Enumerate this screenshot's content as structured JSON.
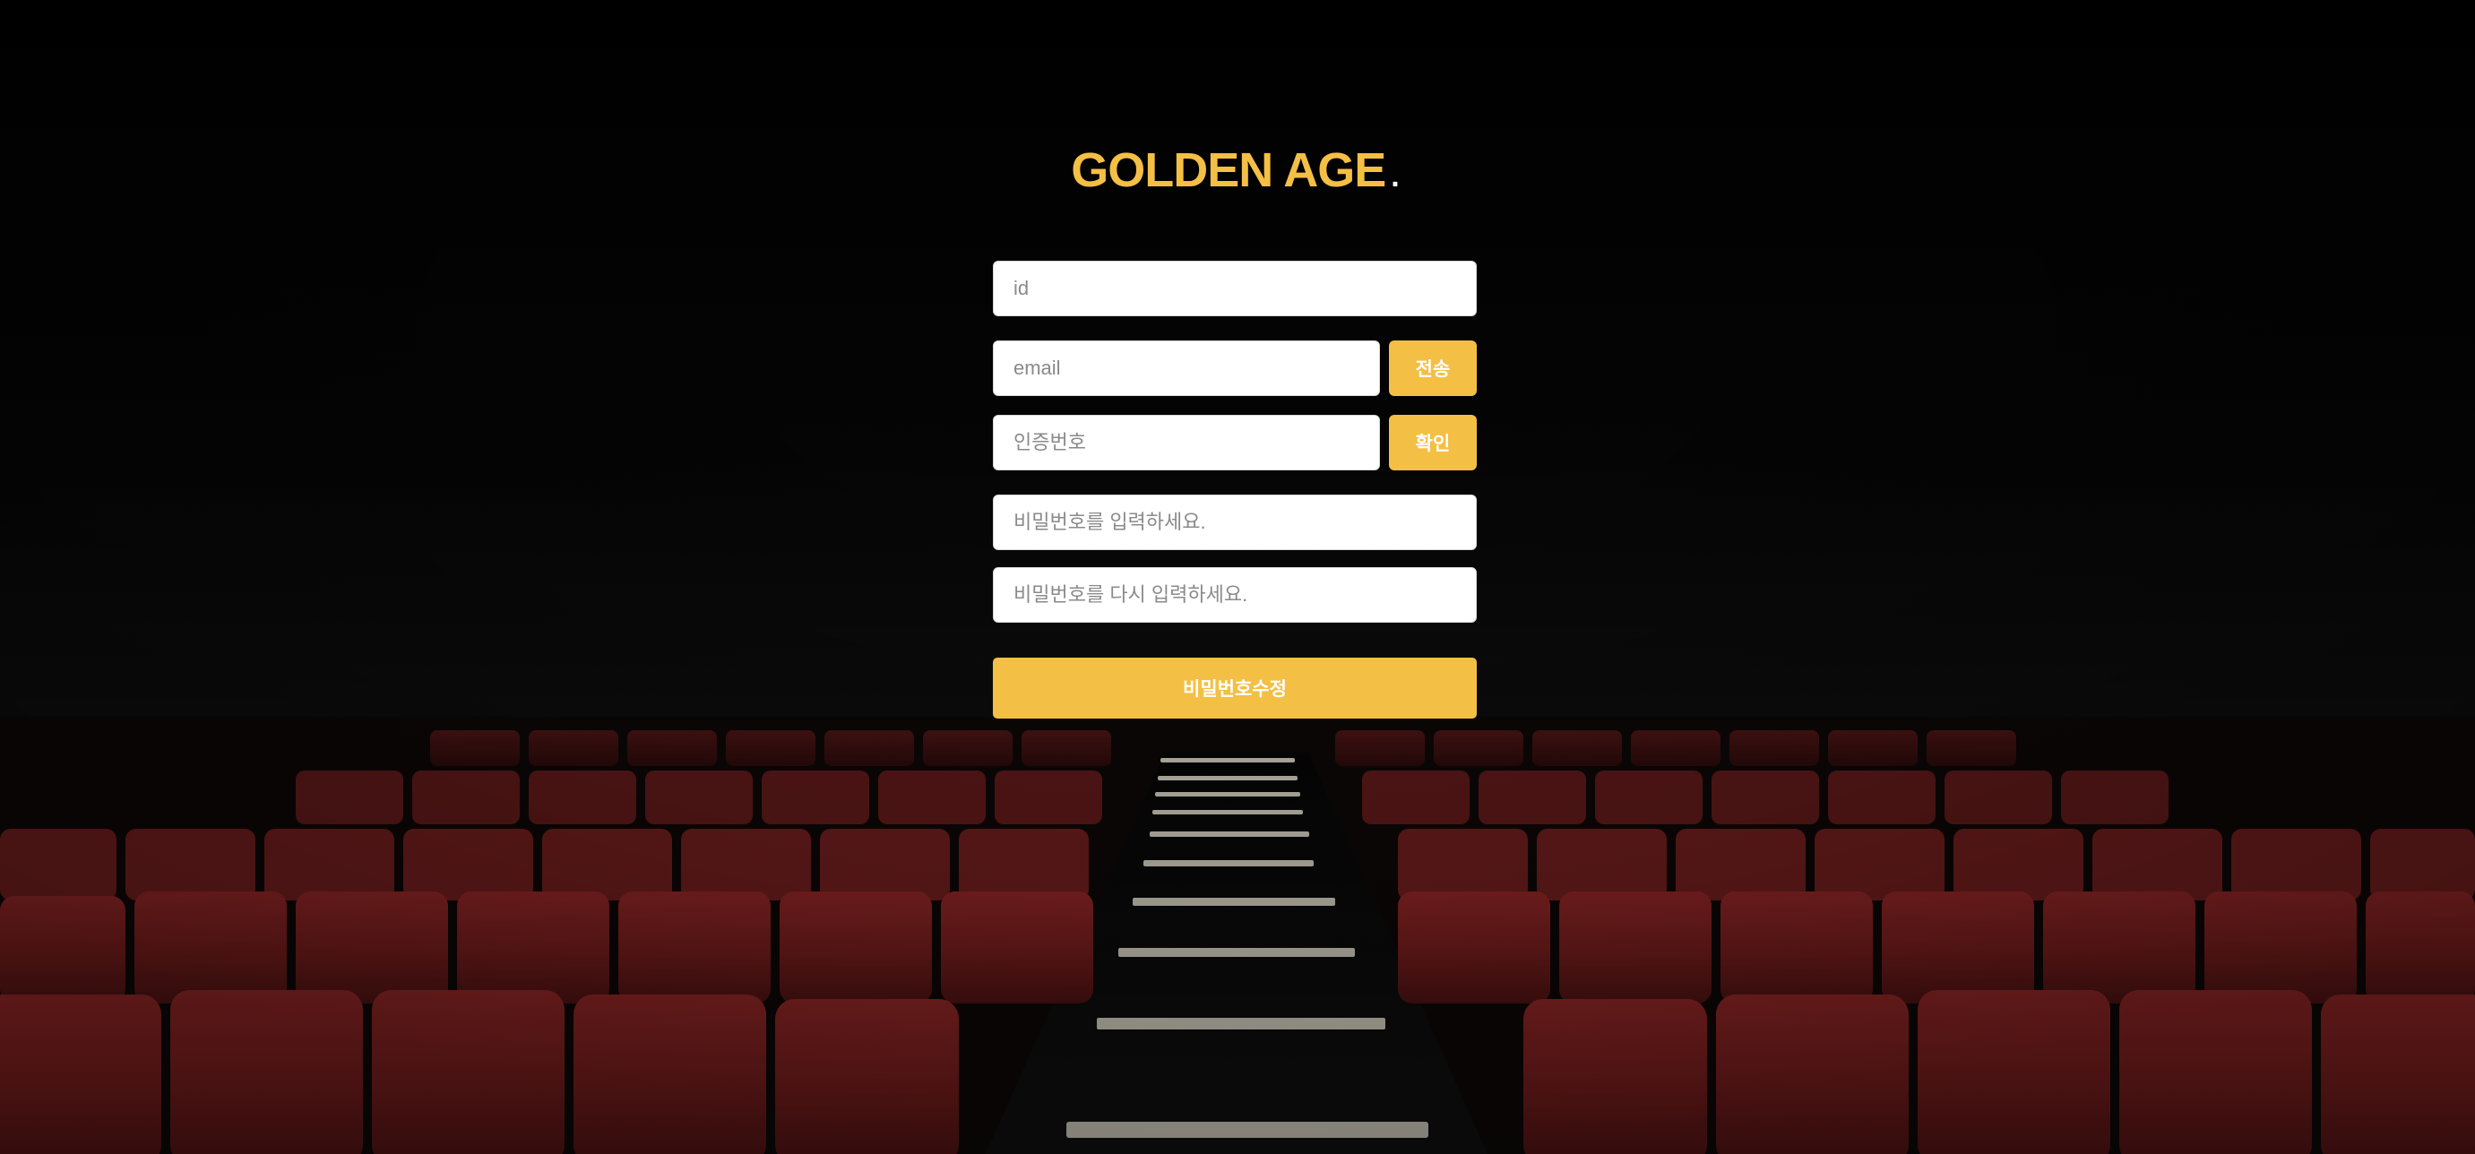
{
  "brand": {
    "name": "GOLDEN AGE",
    "dot": ".",
    "accent_color": "#f4bf45"
  },
  "form": {
    "id_placeholder": "id",
    "email_placeholder": "email",
    "send_label": "전송",
    "code_placeholder": "인증번호",
    "confirm_label": "확인",
    "password_placeholder": "비밀번호를 입력하세요.",
    "password_confirm_placeholder": "비밀번호를 다시 입력하세요.",
    "submit_label": "비밀번호수정"
  },
  "background": {
    "seat_color": "#7e1e1e",
    "scene": "movie-theater-seats"
  }
}
